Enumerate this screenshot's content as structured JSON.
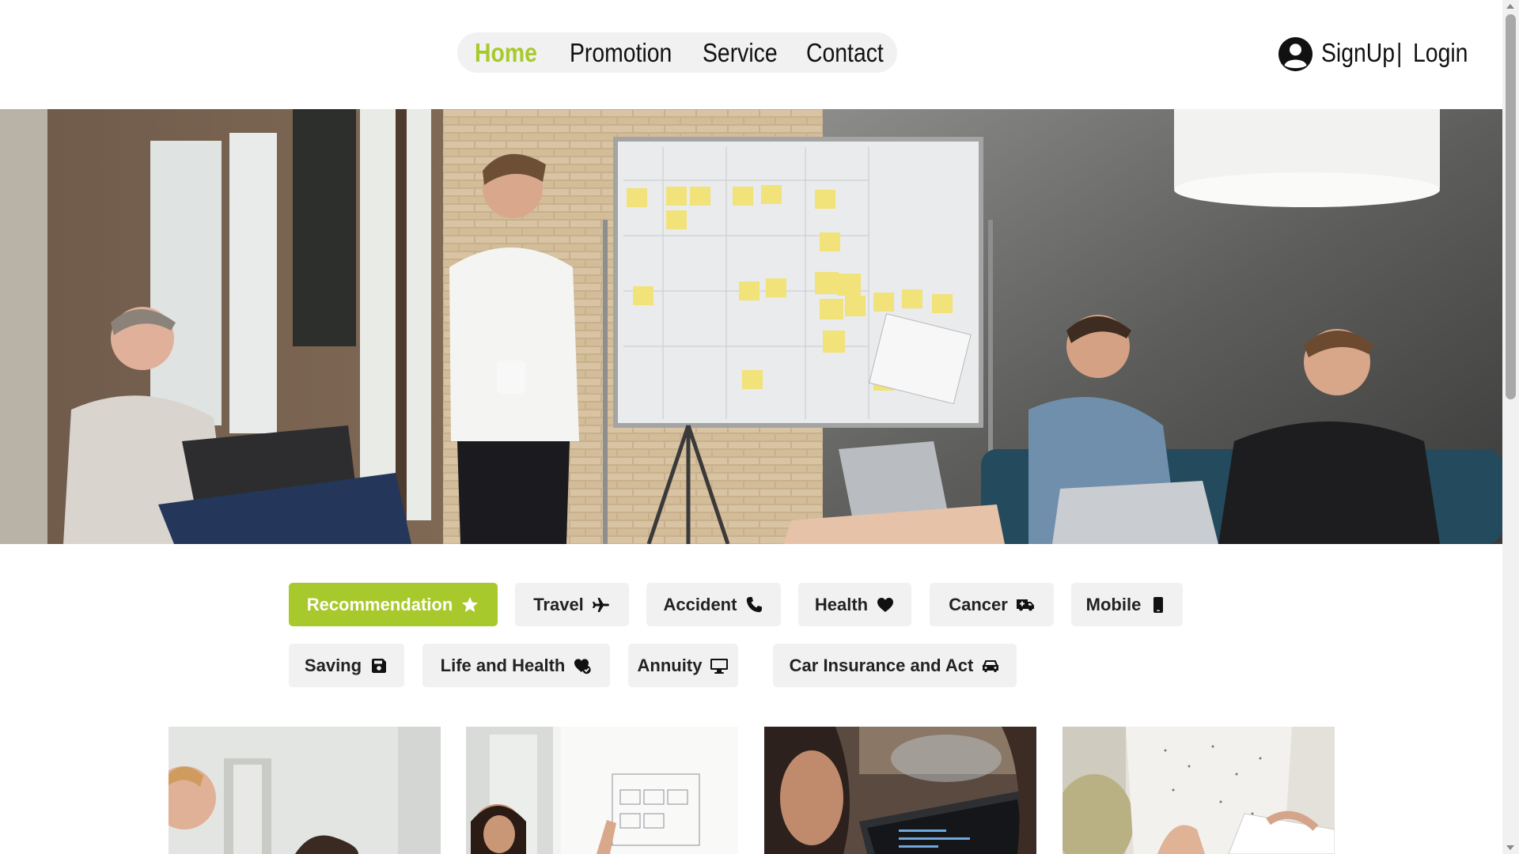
{
  "nav": {
    "links": [
      {
        "label": "Home",
        "active": true
      },
      {
        "label": "Promotion",
        "active": false
      },
      {
        "label": "Service",
        "active": false
      },
      {
        "label": "Contact",
        "active": false
      }
    ]
  },
  "auth": {
    "signup_label": "SignUp",
    "separator": "|",
    "login_label": "Login",
    "icon": "user-circle-icon"
  },
  "categories": [
    {
      "label": "Recommendation",
      "icon": "star-icon",
      "active": true
    },
    {
      "label": "Travel",
      "icon": "plane-icon",
      "active": false
    },
    {
      "label": "Accident",
      "icon": "phone-icon",
      "active": false
    },
    {
      "label": "Health",
      "icon": "heart-icon",
      "active": false
    },
    {
      "label": "Cancer",
      "icon": "ambulance-icon",
      "active": false
    },
    {
      "label": "Mobile",
      "icon": "mobile-icon",
      "active": false
    },
    {
      "label": "Saving",
      "icon": "floppy-disk-icon",
      "active": false
    },
    {
      "label": "Life and Health",
      "icon": "heart-check-icon",
      "active": false
    },
    {
      "label": "Annuity",
      "icon": "monitor-icon",
      "active": false
    },
    {
      "label": "Car Insurance and Act",
      "icon": "car-icon",
      "active": false
    }
  ],
  "colors": {
    "accent": "#a8c92c",
    "chip_bg": "#f1f1f1",
    "text": "#111111"
  }
}
